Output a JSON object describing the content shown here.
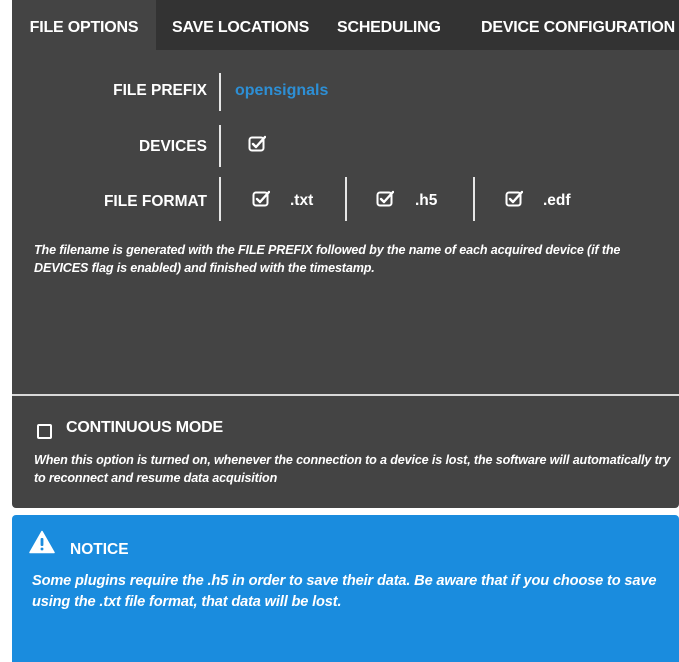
{
  "tabs": [
    {
      "label": "FILE OPTIONS",
      "active": true
    },
    {
      "label": "SAVE LOCATIONS",
      "active": false
    },
    {
      "label": "SCHEDULING",
      "active": false
    },
    {
      "label": "DEVICE CONFIGURATION",
      "active": false
    }
  ],
  "file_prefix": {
    "label": "FILE PREFIX",
    "value": "opensignals"
  },
  "devices": {
    "label": "DEVICES",
    "checked": true
  },
  "file_format": {
    "label": "FILE FORMAT",
    "options": [
      {
        "ext": ".txt",
        "checked": true
      },
      {
        "ext": ".h5",
        "checked": true
      },
      {
        "ext": ".edf",
        "checked": true
      }
    ]
  },
  "description": "The filename is generated with the FILE PREFIX followed by the name of each acquired device (if the DEVICES flag is enabled) and finished with the timestamp.",
  "continuous_mode": {
    "label": "CONTINUOUS MODE",
    "checked": false,
    "description": "When this option is turned on, whenever the connection to a device is lost, the software will automatically try to reconnect and resume data acquisition"
  },
  "notice": {
    "title": "NOTICE",
    "text": "Some plugins require the .h5 in order to save their data. Be aware that if you choose to save using the .txt file format, that data will be lost.",
    "icon": "warning-icon"
  },
  "colors": {
    "panel_bg": "#444444",
    "tabbar_bg": "#333333",
    "accent_blue": "#2d8fd5",
    "notice_bg": "#1a8cde",
    "text": "#ffffff"
  }
}
